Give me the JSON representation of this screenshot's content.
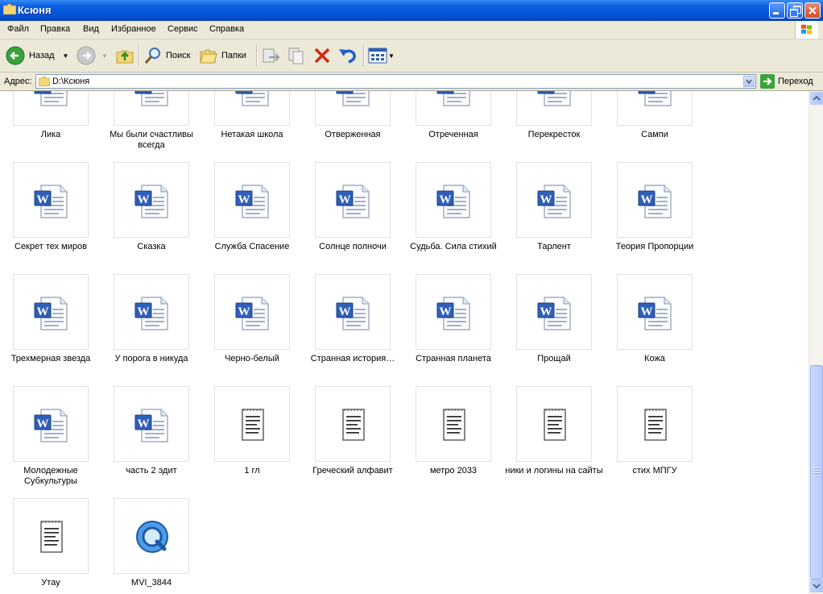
{
  "window": {
    "title": "Ксюня"
  },
  "menu": [
    "Файл",
    "Правка",
    "Вид",
    "Избранное",
    "Сервис",
    "Справка"
  ],
  "toolbar": {
    "back_label": "Назад",
    "search_label": "Поиск",
    "folders_label": "Папки"
  },
  "address": {
    "label": "Адрес:",
    "value": "D:\\Ксюня",
    "go_label": "Переход"
  },
  "files": [
    {
      "name": "Лика",
      "type": "word"
    },
    {
      "name": "Мы были счастливы всегда",
      "type": "word"
    },
    {
      "name": "Нетакая школа",
      "type": "word"
    },
    {
      "name": "Отверженная",
      "type": "word"
    },
    {
      "name": "Отреченная",
      "type": "word"
    },
    {
      "name": "Перекресток",
      "type": "word"
    },
    {
      "name": "Сампи",
      "type": "word"
    },
    {
      "name": "Секрет тех миров",
      "type": "word"
    },
    {
      "name": "Сказка",
      "type": "word"
    },
    {
      "name": "Служба Спасение",
      "type": "word"
    },
    {
      "name": "Солнце полночи",
      "type": "word"
    },
    {
      "name": "Судьба. Сила стихий",
      "type": "word"
    },
    {
      "name": "Тарлент",
      "type": "word"
    },
    {
      "name": "Теория Пропорции",
      "type": "word"
    },
    {
      "name": "Трехмерная звезда",
      "type": "word"
    },
    {
      "name": "У порога в никуда",
      "type": "word"
    },
    {
      "name": "Черно-белый",
      "type": "word"
    },
    {
      "name": "Странная история…",
      "type": "word"
    },
    {
      "name": "Странная планета",
      "type": "word"
    },
    {
      "name": "Прощай",
      "type": "word"
    },
    {
      "name": "Кожа",
      "type": "word"
    },
    {
      "name": "Молодежные Субкультуры",
      "type": "word"
    },
    {
      "name": "часть 2 эдит",
      "type": "word"
    },
    {
      "name": "1 гл",
      "type": "notepad"
    },
    {
      "name": "Греческий алфавит",
      "type": "notepad"
    },
    {
      "name": "метро 2033",
      "type": "notepad"
    },
    {
      "name": "ники и логины на сайты",
      "type": "notepad"
    },
    {
      "name": "стих МПГУ",
      "type": "notepad"
    },
    {
      "name": "Утау",
      "type": "notepad"
    },
    {
      "name": "MVI_3844",
      "type": "quicktime"
    }
  ]
}
